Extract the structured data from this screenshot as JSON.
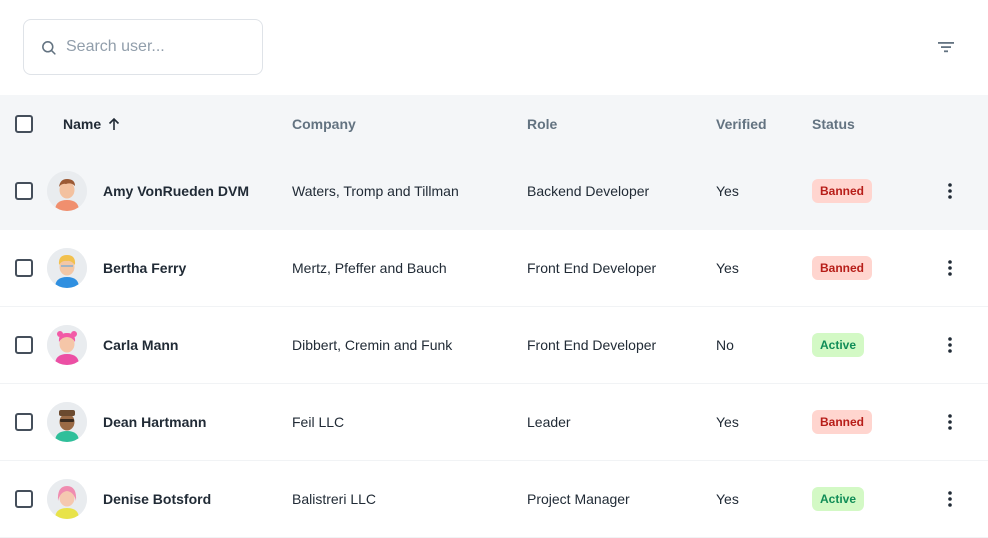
{
  "search": {
    "placeholder": "Search user...",
    "value": "",
    "icon": "search-icon"
  },
  "toolbar": {
    "filter_icon": "filter-list-icon"
  },
  "table": {
    "headers": {
      "name": "Name",
      "company": "Company",
      "role": "Role",
      "verified": "Verified",
      "status": "Status"
    },
    "sort": {
      "column": "name",
      "direction": "asc"
    },
    "rows": [
      {
        "name": "Amy VonRueden DVM",
        "company": "Waters, Tromp and Tillman",
        "role": "Backend Developer",
        "verified": "Yes",
        "status": "Banned",
        "highlighted": true
      },
      {
        "name": "Bertha Ferry",
        "company": "Mertz, Pfeffer and Bauch",
        "role": "Front End Developer",
        "verified": "Yes",
        "status": "Banned",
        "highlighted": false
      },
      {
        "name": "Carla Mann",
        "company": "Dibbert, Cremin and Funk",
        "role": "Front End Developer",
        "verified": "No",
        "status": "Active",
        "highlighted": false
      },
      {
        "name": "Dean Hartmann",
        "company": "Feil LLC",
        "role": "Leader",
        "verified": "Yes",
        "status": "Banned",
        "highlighted": false
      },
      {
        "name": "Denise Botsford",
        "company": "Balistreri LLC",
        "role": "Project Manager",
        "verified": "Yes",
        "status": "Active",
        "highlighted": false
      }
    ]
  },
  "colors": {
    "banned_bg": "#ffd5cf",
    "banned_text": "#b71d18",
    "active_bg": "#d3f9c5",
    "active_text": "#118d57",
    "header_bg": "#f4f6f8"
  }
}
